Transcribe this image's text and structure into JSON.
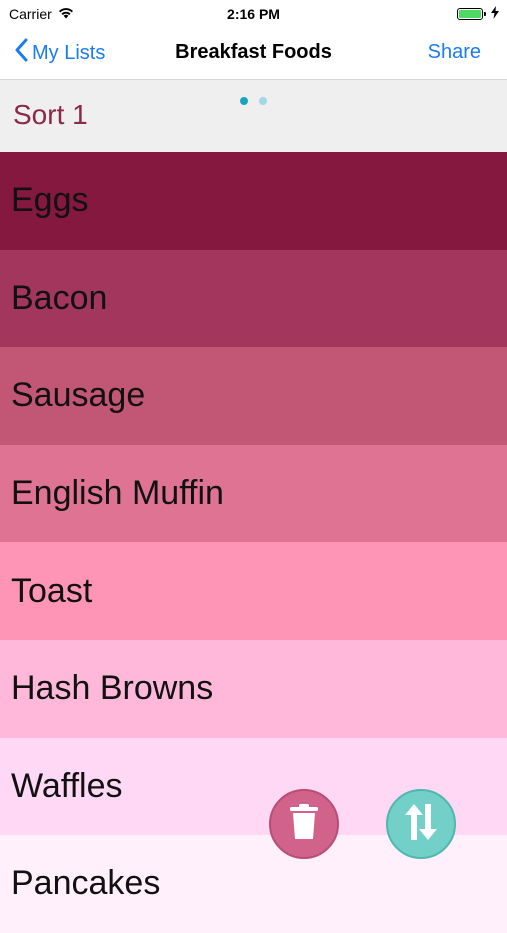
{
  "status_bar": {
    "carrier": "Carrier",
    "time": "2:16 PM"
  },
  "nav": {
    "back_label": "My Lists",
    "title": "Breakfast Foods",
    "share_label": "Share"
  },
  "sort_header": {
    "label": "Sort 1",
    "pages": 2,
    "active_page": 1
  },
  "items": [
    {
      "label": "Eggs",
      "color": "#85183e"
    },
    {
      "label": "Bacon",
      "color": "#a2365c"
    },
    {
      "label": "Sausage",
      "color": "#c25675"
    },
    {
      "label": "English Muffin",
      "color": "#df7394"
    },
    {
      "label": "Toast",
      "color": "#fe94b6"
    },
    {
      "label": "Hash Browns",
      "color": "#ffb8d9"
    },
    {
      "label": "Waffles",
      "color": "#fed8f4"
    },
    {
      "label": "Pancakes",
      "color": "#fff0fc"
    }
  ],
  "actions": {
    "delete_icon": "trash-icon",
    "sort_icon": "sort-arrows-icon"
  }
}
